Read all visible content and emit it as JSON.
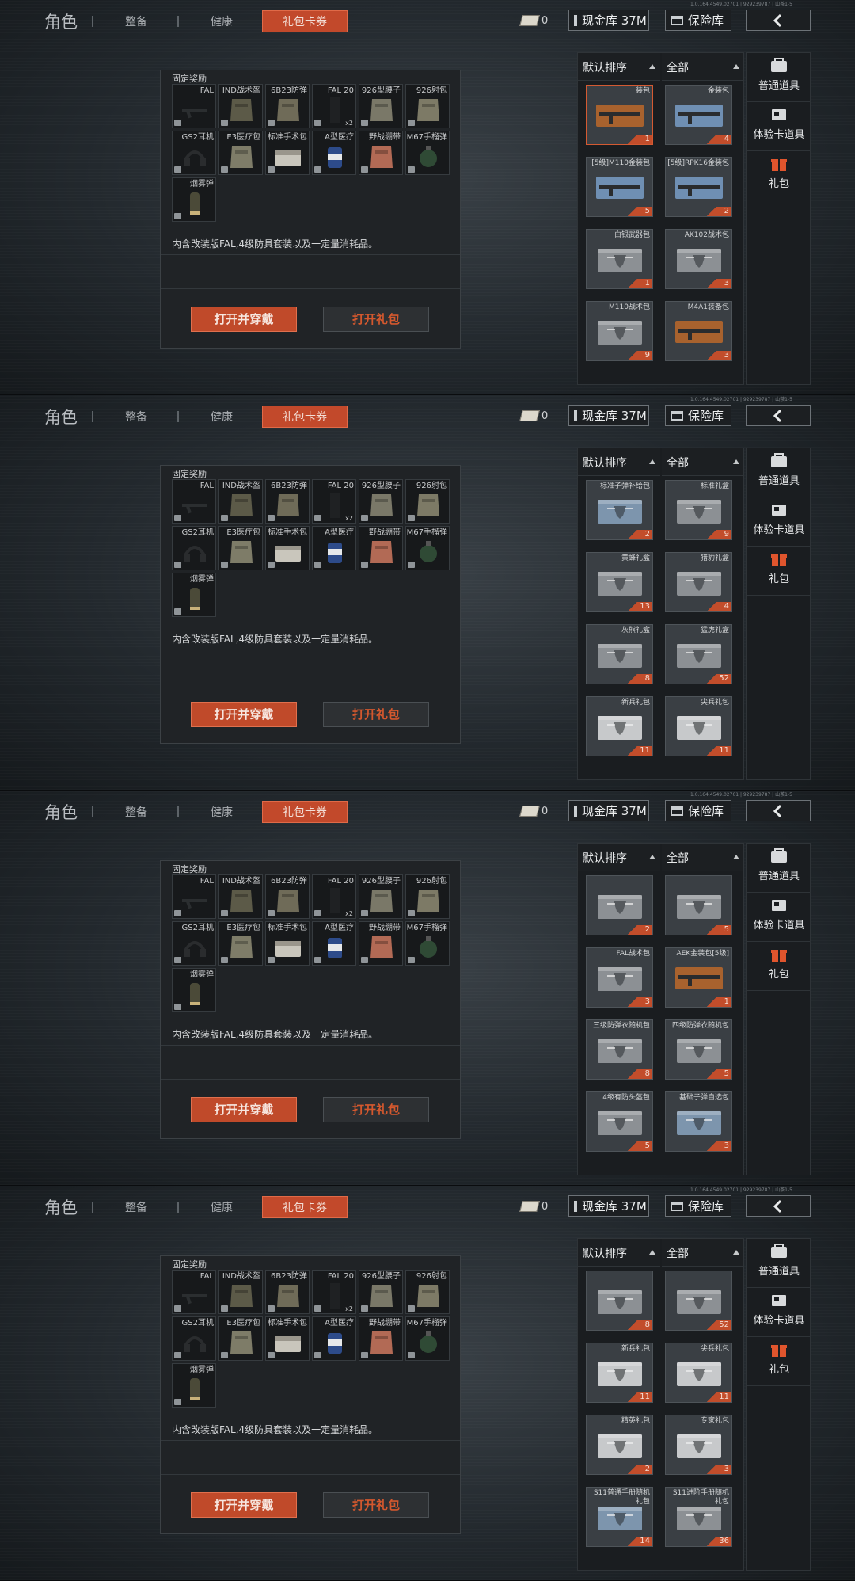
{
  "topbar": {
    "title": "角色",
    "tabs": [
      "整备",
      "健康",
      "礼包卡券"
    ],
    "ticket_count": "0",
    "cash_label": "现金库 37M",
    "vault_label": "保险库"
  },
  "reward_panel": {
    "fixed_label": "固定奖励",
    "items": [
      {
        "name": "FAL",
        "qty": ""
      },
      {
        "name": "IND战术盔",
        "qty": ""
      },
      {
        "name": "6B23防弹",
        "qty": ""
      },
      {
        "name": "FAL 20",
        "qty": "x2"
      },
      {
        "name": "926型腰子",
        "qty": ""
      },
      {
        "name": "926射包",
        "qty": ""
      },
      {
        "name": "GS2耳机",
        "qty": ""
      },
      {
        "name": "E3医疗包",
        "qty": ""
      },
      {
        "name": "标准手术包",
        "qty": ""
      },
      {
        "name": "A型医疗",
        "qty": ""
      },
      {
        "name": "野战绷带",
        "qty": ""
      },
      {
        "name": "M67手榴弹",
        "qty": ""
      },
      {
        "name": "烟雾弹",
        "qty": ""
      }
    ],
    "description": "内含改装版FAL,4级防具套装以及一定量消耗品。",
    "open_wear_label": "打开并穿戴",
    "open_label": "打开礼包"
  },
  "list_header": {
    "sort_default": "默认排序",
    "sort_all": "全部"
  },
  "categories": [
    "普通道具",
    "体验卡道具",
    "礼包"
  ],
  "frames": [
    {
      "version": "1.0.164.4549.02701 | 929239787 | 山茶1-5",
      "cards": [
        {
          "name": "装包",
          "count": "1",
          "style": "rifle-orange"
        },
        {
          "name": "金装包",
          "count": "4",
          "style": "rifle-blue"
        },
        {
          "name": "[5级]M110金装包",
          "count": "5",
          "style": "rifle-blue"
        },
        {
          "name": "[5级]RPK16金装包",
          "count": "2",
          "style": "rifle-blue"
        },
        {
          "name": "白银武器包",
          "count": "1",
          "style": "case-grey"
        },
        {
          "name": "AK102战术包",
          "count": "3",
          "style": "case-grey"
        },
        {
          "name": "M110战术包",
          "count": "9",
          "style": "case-grey"
        },
        {
          "name": "M4A1装备包",
          "count": "3",
          "style": "rifle-orange"
        }
      ]
    },
    {
      "version": "1.0.164.4549.02701 | 929239787 | 山茶1-5",
      "cards": [
        {
          "name": "标准子弹补给包",
          "count": "2",
          "style": "case-blue"
        },
        {
          "name": "标准礼盒",
          "count": "9",
          "style": "case-grey"
        },
        {
          "name": "黄蜂礼盒",
          "count": "13",
          "style": "case-grey"
        },
        {
          "name": "猎豹礼盒",
          "count": "4",
          "style": "case-grey"
        },
        {
          "name": "灰熊礼盒",
          "count": "8",
          "style": "case-grey"
        },
        {
          "name": "猛虎礼盒",
          "count": "52",
          "style": "case-grey"
        },
        {
          "name": "新兵礼包",
          "count": "11",
          "style": "case-white"
        },
        {
          "name": "尖兵礼包",
          "count": "11",
          "style": "case-white"
        }
      ]
    },
    {
      "version": "1.0.164.4549.02701 | 929239787 | 山茶1-5",
      "cards": [
        {
          "name": "",
          "count": "2",
          "style": "case-grey"
        },
        {
          "name": "",
          "count": "5",
          "style": "case-grey"
        },
        {
          "name": "FAL战术包",
          "count": "3",
          "style": "case-grey"
        },
        {
          "name": "AEK金装包[5级]",
          "count": "1",
          "style": "rifle-orange"
        },
        {
          "name": "三级防弹衣随机包",
          "count": "8",
          "style": "case-grey"
        },
        {
          "name": "四级防弹衣随机包",
          "count": "5",
          "style": "case-grey"
        },
        {
          "name": "4级有防头盔包",
          "count": "5",
          "style": "case-grey"
        },
        {
          "name": "基础子弹自选包",
          "count": "3",
          "style": "case-blue"
        }
      ]
    },
    {
      "version": "1.0.164.4549.02701 | 929239787 | 山茶1-5",
      "cards": [
        {
          "name": "",
          "count": "8",
          "style": "case-grey"
        },
        {
          "name": "",
          "count": "52",
          "style": "case-grey"
        },
        {
          "name": "新兵礼包",
          "count": "11",
          "style": "case-white"
        },
        {
          "name": "尖兵礼包",
          "count": "11",
          "style": "case-white"
        },
        {
          "name": "精英礼包",
          "count": "2",
          "style": "case-white"
        },
        {
          "name": "专家礼包",
          "count": "3",
          "style": "case-white"
        },
        {
          "name": "S11普通手册随机礼包",
          "count": "14",
          "style": "case-blue"
        },
        {
          "name": "S11进阶手册随机礼包",
          "count": "36",
          "style": "case-grey"
        }
      ]
    }
  ],
  "colors": {
    "accent": "#c2492b",
    "panel": "#202326",
    "text": "#d4d6d8"
  }
}
